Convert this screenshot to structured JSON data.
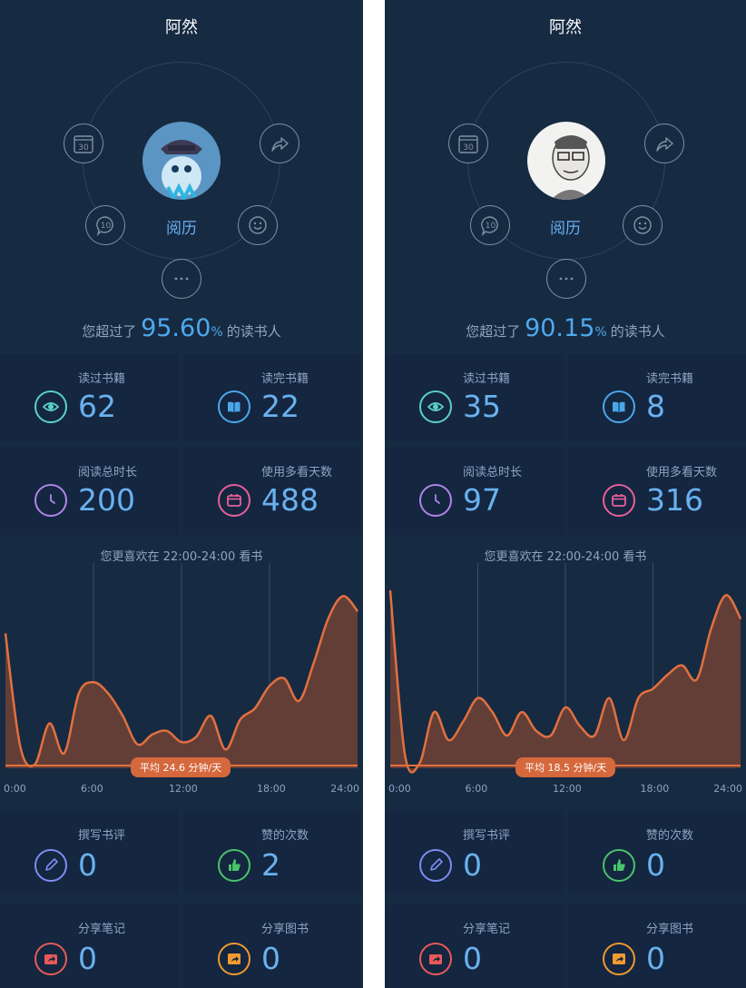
{
  "panels": [
    {
      "title": "阿然",
      "reading_label": "阅历",
      "calendar_num": "30",
      "chat_num": "10",
      "exceed": {
        "prefix": "您超过了",
        "percent": "95.60",
        "percent_sign": "%",
        "suffix": "的读书人"
      },
      "stats": [
        {
          "label": "读过书籍",
          "value": "62",
          "icon": "eye-icon",
          "color": "#5ad1c5"
        },
        {
          "label": "读完书籍",
          "value": "22",
          "icon": "book-icon",
          "color": "#4aa8ea"
        },
        {
          "label": "阅读总时长",
          "value": "200",
          "icon": "clock-icon",
          "color": "#b184e8"
        },
        {
          "label": "使用多看天数",
          "value": "488",
          "icon": "calendar-icon",
          "color": "#e8609a"
        }
      ],
      "preference_text": "您更喜欢在 22:00-24:00 看书",
      "average_text": "平均 24.6 分钟/天",
      "social": [
        {
          "label": "撰写书评",
          "value": "0",
          "icon": "pencil-icon",
          "color": "#7c8df0"
        },
        {
          "label": "赞的次数",
          "value": "2",
          "icon": "thumbs-up-icon",
          "color": "#48c46a"
        },
        {
          "label": "分享笔记",
          "value": "0",
          "icon": "share-note-icon",
          "color": "#e85a58"
        },
        {
          "label": "分享图书",
          "value": "0",
          "icon": "share-book-icon",
          "color": "#f09a30"
        }
      ]
    },
    {
      "title": "阿然",
      "reading_label": "阅历",
      "calendar_num": "30",
      "chat_num": "10",
      "exceed": {
        "prefix": "您超过了",
        "percent": "90.15",
        "percent_sign": "%",
        "suffix": "的读书人"
      },
      "stats": [
        {
          "label": "读过书籍",
          "value": "35",
          "icon": "eye-icon",
          "color": "#5ad1c5"
        },
        {
          "label": "读完书籍",
          "value": "8",
          "icon": "book-icon",
          "color": "#4aa8ea"
        },
        {
          "label": "阅读总时长",
          "value": "97",
          "icon": "clock-icon",
          "color": "#b184e8"
        },
        {
          "label": "使用多看天数",
          "value": "316",
          "icon": "calendar-icon",
          "color": "#e8609a"
        }
      ],
      "preference_text": "您更喜欢在 22:00-24:00 看书",
      "average_text": "平均 18.5 分钟/天",
      "social": [
        {
          "label": "撰写书评",
          "value": "0",
          "icon": "pencil-icon",
          "color": "#7c8df0"
        },
        {
          "label": "赞的次数",
          "value": "0",
          "icon": "thumbs-up-icon",
          "color": "#48c46a"
        },
        {
          "label": "分享笔记",
          "value": "0",
          "icon": "share-note-icon",
          "color": "#e85a58"
        },
        {
          "label": "分享图书",
          "value": "0",
          "icon": "share-book-icon",
          "color": "#f09a30"
        }
      ]
    }
  ],
  "chart_data": [
    {
      "type": "area",
      "x_unit": "hour",
      "xlim": [
        0,
        24
      ],
      "x_ticks": [
        "0:00",
        "6:00",
        "12:00",
        "18:00",
        "24:00"
      ],
      "average": 24.6,
      "x": [
        0,
        1,
        2,
        3,
        4,
        5,
        6,
        7,
        8,
        9,
        10,
        11,
        12,
        13,
        14,
        15,
        16,
        17,
        18,
        19,
        20,
        21,
        22,
        23,
        24
      ],
      "values": [
        18,
        3,
        0.5,
        6,
        2,
        10,
        11.5,
        10,
        7,
        3.2,
        4.5,
        5,
        3.5,
        4.2,
        7,
        2.5,
        6.5,
        8,
        11,
        12,
        9,
        14,
        20,
        23,
        21
      ],
      "ylim": [
        0,
        25
      ]
    },
    {
      "type": "area",
      "x_unit": "hour",
      "xlim": [
        0,
        24
      ],
      "x_ticks": [
        "0:00",
        "6:00",
        "12:00",
        "18:00",
        "24:00"
      ],
      "average": 18.5,
      "x": [
        0,
        1,
        2,
        3,
        4,
        5,
        6,
        7,
        8,
        9,
        10,
        11,
        12,
        13,
        14,
        15,
        16,
        17,
        18,
        19,
        20,
        21,
        22,
        23,
        24
      ],
      "values": [
        19,
        1.5,
        0.5,
        6,
        3,
        5,
        7.5,
        6,
        3.5,
        6,
        4,
        3.5,
        6.5,
        4.5,
        3.5,
        7.5,
        3,
        7.5,
        8.5,
        10,
        11,
        9.5,
        15,
        18.5,
        16
      ],
      "ylim": [
        0,
        20
      ]
    }
  ]
}
